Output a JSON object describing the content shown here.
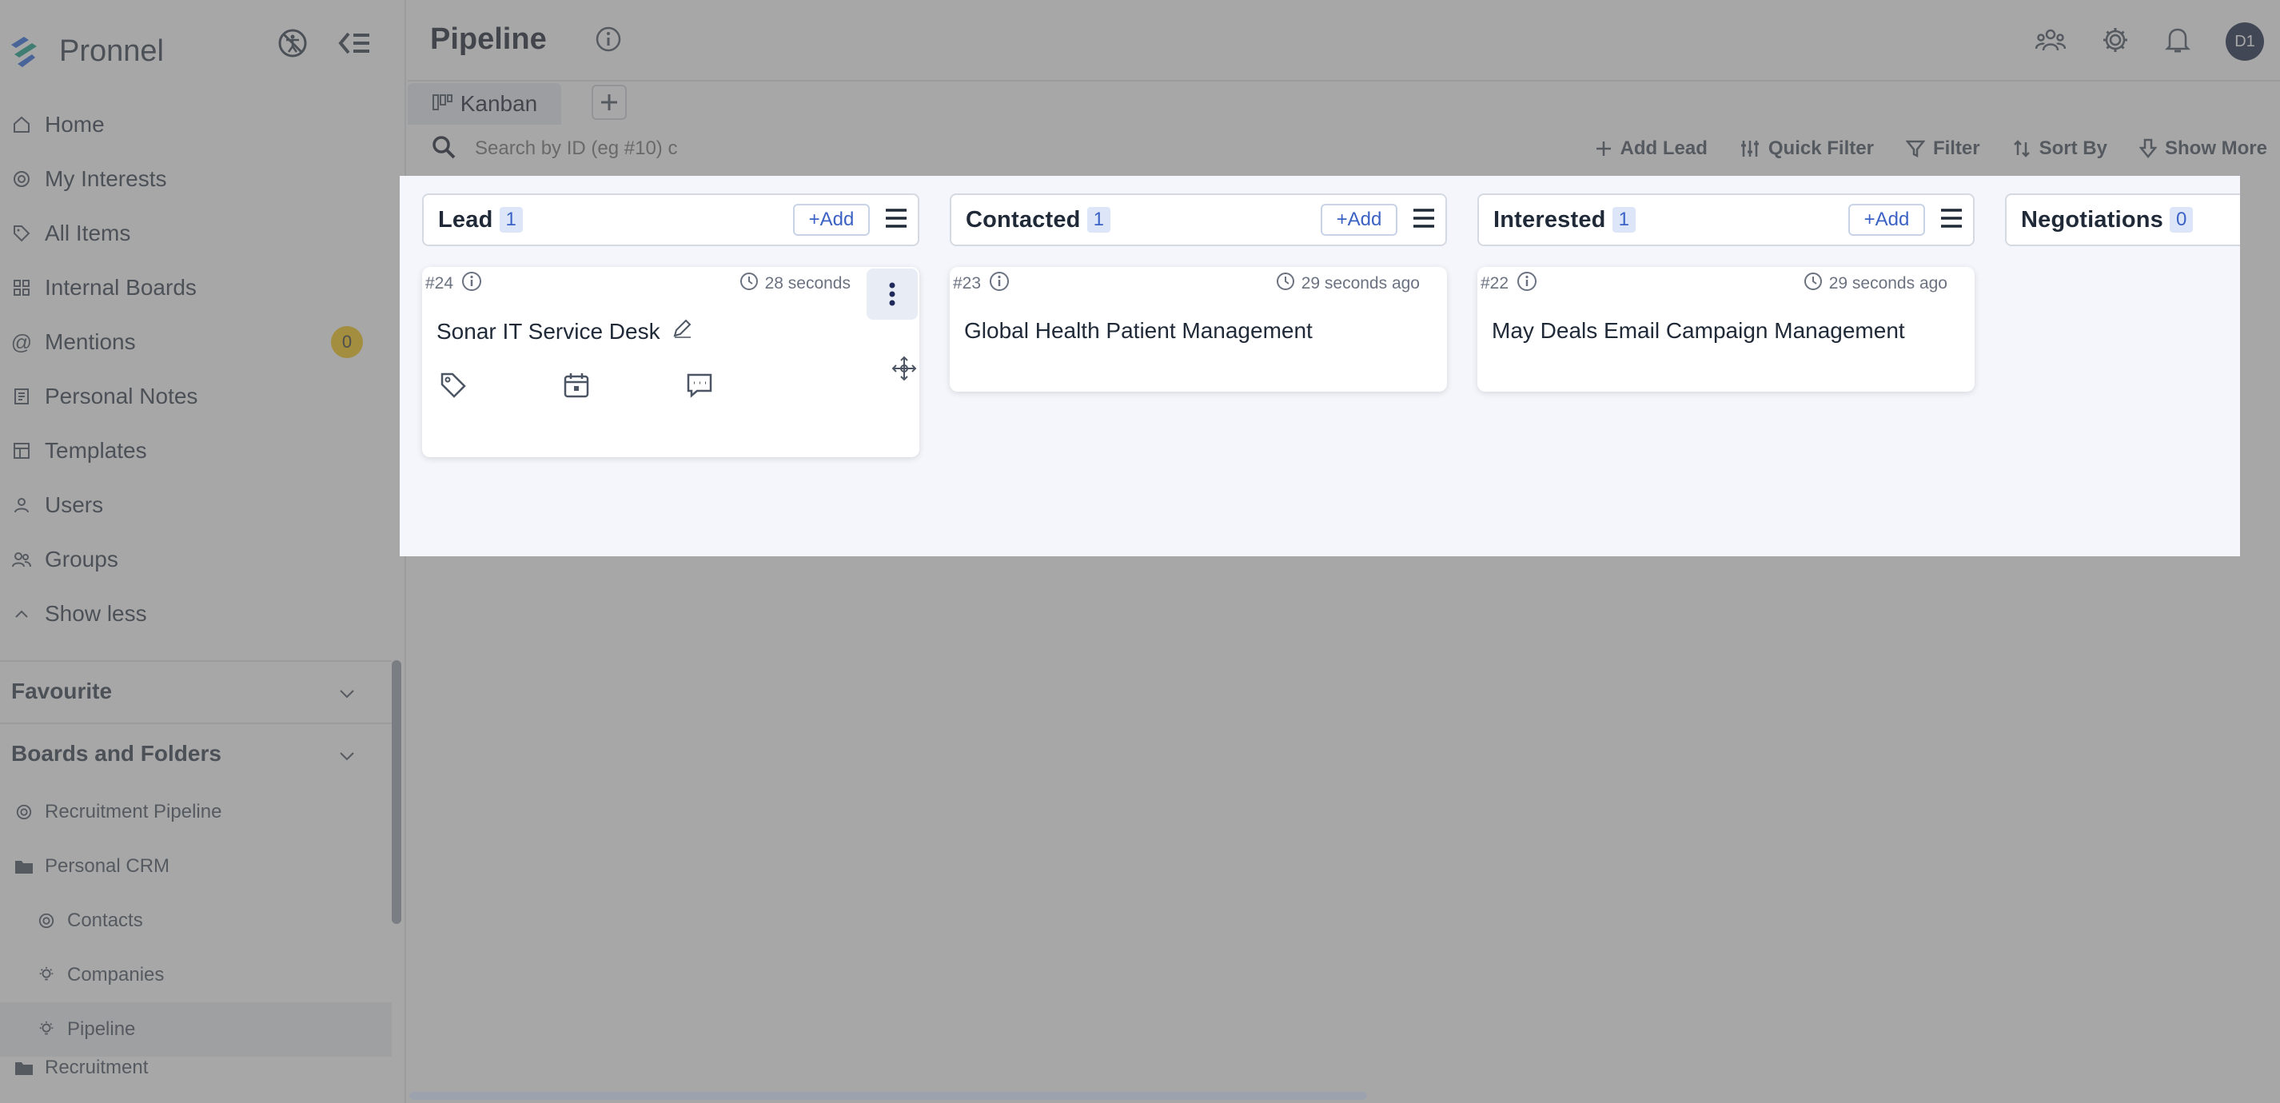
{
  "app": {
    "name": "Pronnel"
  },
  "sidebar": {
    "nav": [
      {
        "label": "Home",
        "icon": "home-icon"
      },
      {
        "label": "My Interests",
        "icon": "target-icon"
      },
      {
        "label": "All Items",
        "icon": "tag-icon"
      },
      {
        "label": "Internal Boards",
        "icon": "grid-icon"
      },
      {
        "label": "Mentions",
        "icon": "at-icon",
        "badge": "0"
      },
      {
        "label": "Personal Notes",
        "icon": "note-icon"
      },
      {
        "label": "Templates",
        "icon": "template-icon"
      },
      {
        "label": "Users",
        "icon": "user-icon"
      },
      {
        "label": "Groups",
        "icon": "group-icon"
      },
      {
        "label": "Show less",
        "icon": "chevron-up-icon"
      }
    ],
    "favourite_label": "Favourite",
    "boards_label": "Boards and Folders",
    "tree": [
      {
        "label": "Recruitment Pipeline",
        "icon": "target-icon",
        "level": 0
      },
      {
        "label": "Personal CRM",
        "icon": "folder-icon",
        "level": 0
      },
      {
        "label": "Contacts",
        "icon": "target-icon",
        "level": 1
      },
      {
        "label": "Companies",
        "icon": "bulb-icon",
        "level": 1
      },
      {
        "label": "Pipeline",
        "icon": "bulb-icon",
        "level": 1,
        "active": true
      },
      {
        "label": "Recruitment",
        "icon": "folder-icon",
        "level": 0
      }
    ]
  },
  "header": {
    "title": "Pipeline",
    "avatar": "D1"
  },
  "tabs": [
    {
      "label": "Kanban"
    }
  ],
  "toolbar": {
    "search_placeholder": "Search by ID (eg #10) c",
    "add_lead": "Add Lead",
    "quick_filter": "Quick Filter",
    "filter": "Filter",
    "sort_by": "Sort By",
    "show_more": "Show More"
  },
  "board": {
    "add_label": "+Add",
    "columns": [
      {
        "title": "Lead",
        "count": "1",
        "cards": [
          {
            "id": "#24",
            "time": "28 seconds",
            "title": "Sonar IT Service Desk"
          }
        ]
      },
      {
        "title": "Contacted",
        "count": "1",
        "cards": [
          {
            "id": "#23",
            "time": "29 seconds ago",
            "title": "Global Health Patient Management"
          }
        ]
      },
      {
        "title": "Interested",
        "count": "1",
        "cards": [
          {
            "id": "#22",
            "time": "29 seconds ago",
            "title": "May Deals Email Campaign Management"
          }
        ]
      },
      {
        "title": "Negotiations",
        "count": "0",
        "cards": []
      }
    ]
  },
  "colors": {
    "accent": "#3b62c4",
    "badge": "#f5c518",
    "overlay": "#5f5f5f"
  }
}
